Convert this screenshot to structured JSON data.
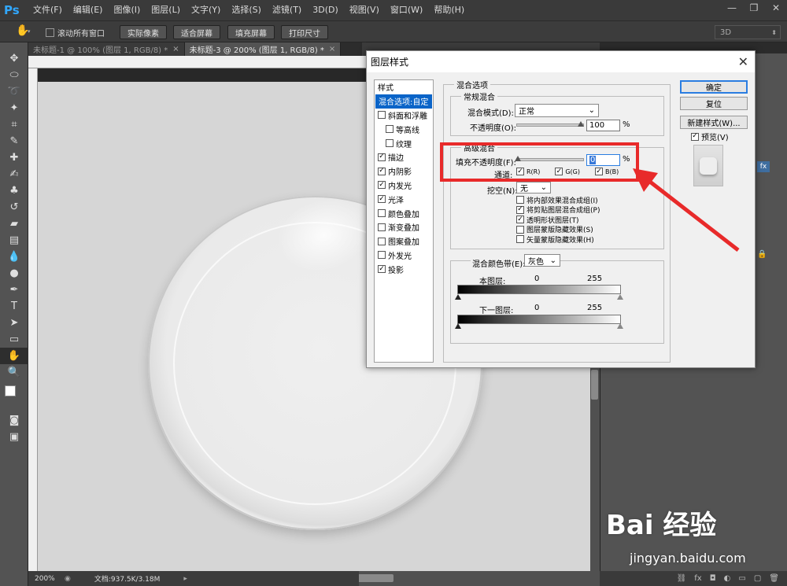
{
  "app": {
    "logo": "Ps"
  },
  "menu": [
    "文件(F)",
    "编辑(E)",
    "图像(I)",
    "图层(L)",
    "文字(Y)",
    "选择(S)",
    "滤镜(T)",
    "3D(D)",
    "视图(V)",
    "窗口(W)",
    "帮助(H)"
  ],
  "window_controls": {
    "minimize": "—",
    "restore": "❐",
    "close": "✕"
  },
  "options_bar": {
    "scroll_all_label": "滚动所有窗口",
    "buttons": [
      "实际像素",
      "适合屏幕",
      "填充屏幕",
      "打印尺寸"
    ],
    "workspace": "3D"
  },
  "tabs": [
    {
      "label": "未标题-1 @ 100% (图层 1, RGB/8) *",
      "active": false
    },
    {
      "label": "未标题-3 @ 200% (图层 1, RGB/8) *",
      "active": true
    }
  ],
  "status": {
    "zoom": "200%",
    "doc": "文档:937.5K/3.18M"
  },
  "dialog": {
    "title": "图层样式",
    "close": "✕",
    "styles_header": "样式",
    "styles": [
      {
        "label": "混合选项:自定",
        "checked": null,
        "selected": true,
        "indent": false
      },
      {
        "label": "斜面和浮雕",
        "checked": false,
        "selected": false,
        "indent": false
      },
      {
        "label": "等高线",
        "checked": false,
        "selected": false,
        "indent": true
      },
      {
        "label": "纹理",
        "checked": false,
        "selected": false,
        "indent": true
      },
      {
        "label": "描边",
        "checked": true,
        "selected": false,
        "indent": false
      },
      {
        "label": "内阴影",
        "checked": true,
        "selected": false,
        "indent": false
      },
      {
        "label": "内发光",
        "checked": true,
        "selected": false,
        "indent": false
      },
      {
        "label": "光泽",
        "checked": true,
        "selected": false,
        "indent": false
      },
      {
        "label": "颜色叠加",
        "checked": false,
        "selected": false,
        "indent": false
      },
      {
        "label": "渐变叠加",
        "checked": false,
        "selected": false,
        "indent": false
      },
      {
        "label": "图案叠加",
        "checked": false,
        "selected": false,
        "indent": false
      },
      {
        "label": "外发光",
        "checked": false,
        "selected": false,
        "indent": false
      },
      {
        "label": "投影",
        "checked": true,
        "selected": false,
        "indent": false
      }
    ],
    "blend_options_title": "混合选项",
    "general": {
      "title": "常规混合",
      "mode_label": "混合模式(D):",
      "mode_value": "正常",
      "opacity_label": "不透明度(O):",
      "opacity_value": "100",
      "percent": "%"
    },
    "advanced": {
      "title": "高级混合",
      "fill_label": "填充不透明度(F):",
      "fill_value": "0",
      "percent": "%",
      "channels_label": "通道:",
      "channels": [
        {
          "label": "R(R)",
          "checked": true
        },
        {
          "label": "G(G)",
          "checked": true
        },
        {
          "label": "B(B)",
          "checked": true
        }
      ],
      "knockout_label": "挖空(N):",
      "knockout_value": "无",
      "options": [
        {
          "label": "将内部效果混合成组(I)",
          "checked": false
        },
        {
          "label": "将剪贴图层混合成组(P)",
          "checked": true
        },
        {
          "label": "透明形状图层(T)",
          "checked": true
        },
        {
          "label": "图层蒙版隐藏效果(S)",
          "checked": false
        },
        {
          "label": "矢量蒙版隐藏效果(H)",
          "checked": false
        }
      ]
    },
    "blend_if": {
      "label": "混合颜色带(E):",
      "value": "灰色",
      "this_layer": "本图层:",
      "underlying": "下一图层:",
      "min": "0",
      "max": "255"
    },
    "buttons": {
      "ok": "确定",
      "reset": "复位",
      "new_style": "新建样式(W)...",
      "preview": "预览(V)"
    },
    "preview_checked": true
  },
  "watermark": {
    "brand": "Bai 经验",
    "url": "jingyan.baidu.com"
  },
  "colors": {
    "highlight_box": "#e82a2a",
    "selection": "#0a64c8",
    "ps_blue": "#31a8ff"
  }
}
